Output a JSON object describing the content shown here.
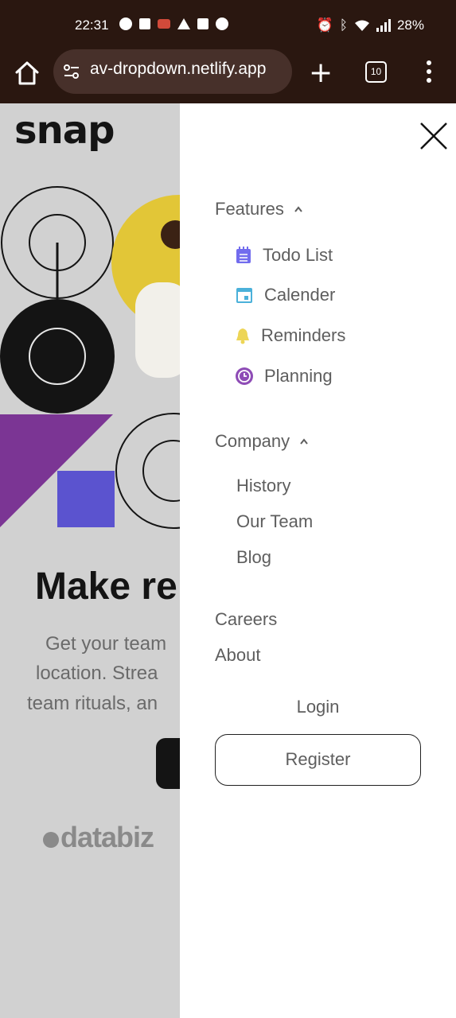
{
  "status_bar": {
    "time": "22:31",
    "battery": "28%"
  },
  "browser": {
    "url": "av-dropdown.netlify.app",
    "tab_count": "10"
  },
  "page": {
    "logo": "snap",
    "headline": "Make re",
    "subtext_lines": [
      "Get your team",
      "location. Strea",
      "team rituals, an"
    ],
    "partner_logo": "databiz"
  },
  "drawer": {
    "features": {
      "label": "Features",
      "items": [
        {
          "label": "Todo List",
          "icon": "todo-list-icon",
          "color": "#726cee"
        },
        {
          "label": "Calender",
          "icon": "calendar-icon",
          "color": "#4bb1da"
        },
        {
          "label": "Reminders",
          "icon": "bell-icon",
          "color": "#edd556"
        },
        {
          "label": "Planning",
          "icon": "clock-icon",
          "color": "#8e4cb6"
        }
      ]
    },
    "company": {
      "label": "Company",
      "items": [
        "History",
        "Our Team",
        "Blog"
      ]
    },
    "careers": "Careers",
    "about": "About",
    "login": "Login",
    "register": "Register"
  }
}
